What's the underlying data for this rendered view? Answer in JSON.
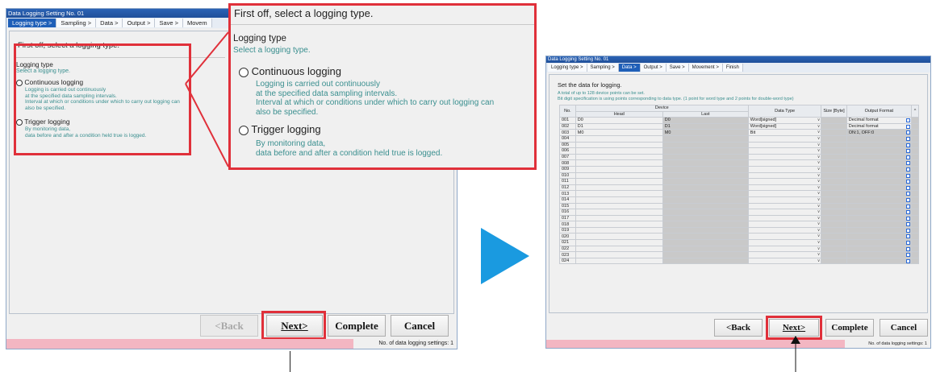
{
  "left_window": {
    "title": "Data Logging Setting No. 01",
    "tabs": [
      "Logging type >",
      "Sampling >",
      "Data >",
      "Output >",
      "Save >",
      "Movem"
    ],
    "instruction": "First off, select a logging type.",
    "group_label": "Logging type",
    "group_hint": "Select a logging type.",
    "option1_label": "Continuous logging",
    "option1_desc": [
      "Logging is carried out continuously",
      "at the specified data sampling intervals.",
      "Interval at which or conditions under which to carry out logging can",
      "also be specified."
    ],
    "option2_label": "Trigger logging",
    "option2_desc": [
      "By monitoring data,",
      "data before and after a condition held true is logged."
    ],
    "back_label": "<Back",
    "next_label": "Next>",
    "complete_label": "Complete",
    "cancel_label": "Cancel",
    "status_text": "No. of data logging settings: 1"
  },
  "zoom": {
    "instruction": "First off, select a logging type.",
    "group_label": "Logging type",
    "group_hint": "Select a logging type.",
    "option1_label": "Continuous logging",
    "option1_desc": [
      "Logging is carried out continuously",
      "at the specified data sampling intervals.",
      "Interval at which or conditions under which to carry out logging can",
      "also be specified."
    ],
    "option2_label": "Trigger logging",
    "option2_desc": [
      "By monitoring data,",
      "data before and after a condition held true is logged."
    ]
  },
  "right_window": {
    "title": "Data Logging Setting No. 01",
    "tabs": [
      "Logging type >",
      "Sampling >",
      "Data >",
      "Output >",
      "Save >",
      "Movement >",
      "Finish"
    ],
    "instruction": "Set the data for logging.",
    "note1": "A total of up to 128 device points can be set.",
    "note2": "Bit digit specification is using points corresponding to data type. (1 point for word type and 2 points for double-word type)",
    "headers": {
      "no": "No.",
      "device": "Device",
      "head": "Head",
      "last": "Last",
      "data_type": "Data Type",
      "size": "Size [Byte]",
      "output_format": "Output Format"
    },
    "rows": [
      {
        "no": "001",
        "head": "D0",
        "last": "D0",
        "type": "Word[signed]",
        "format": "Decimal format"
      },
      {
        "no": "002",
        "head": "D1",
        "last": "D1",
        "type": "Word[signed]",
        "format": "Decimal format"
      },
      {
        "no": "003",
        "head": "M0",
        "last": "M0",
        "type": "Bit",
        "format": "ON:1, OFF:0"
      },
      {
        "no": "004"
      },
      {
        "no": "005"
      },
      {
        "no": "006"
      },
      {
        "no": "007"
      },
      {
        "no": "008"
      },
      {
        "no": "009"
      },
      {
        "no": "010"
      },
      {
        "no": "011"
      },
      {
        "no": "012"
      },
      {
        "no": "013"
      },
      {
        "no": "014"
      },
      {
        "no": "015"
      },
      {
        "no": "016"
      },
      {
        "no": "017"
      },
      {
        "no": "018"
      },
      {
        "no": "019"
      },
      {
        "no": "020"
      },
      {
        "no": "021"
      },
      {
        "no": "022"
      },
      {
        "no": "023"
      },
      {
        "no": "024"
      }
    ],
    "back_label": "<Back",
    "next_label": "Next>",
    "complete_label": "Complete",
    "cancel_label": "Cancel",
    "status_text": "No. of data logging settings: 1"
  },
  "colors": {
    "highlight": "#e0303a",
    "arrow": "#1a9ae0",
    "active_tab": "#1f5fb8",
    "hint_text": "#3a8f8f"
  }
}
